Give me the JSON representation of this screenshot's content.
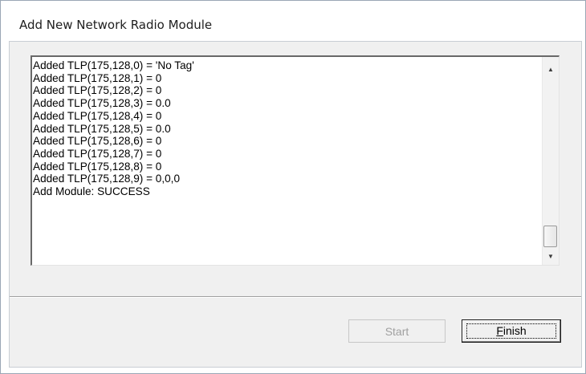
{
  "window": {
    "title": "Add New Network Radio Module"
  },
  "log": {
    "lines": [
      "Added TLP(175,128,0) = 'No Tag'",
      "Added TLP(175,128,1) = 0",
      "Added TLP(175,128,2) = 0",
      "Added TLP(175,128,3) = 0.0",
      "Added TLP(175,128,4) = 0",
      "Added TLP(175,128,5) = 0.0",
      "Added TLP(175,128,6) = 0",
      "Added TLP(175,128,7) = 0",
      "Added TLP(175,128,8) = 0",
      "Added TLP(175,128,9) = 0,0,0",
      "Add Module: SUCCESS"
    ],
    "scroll_position": 0.92
  },
  "buttons": {
    "start_label": "Start",
    "start_enabled": false,
    "finish_mnemonic": "F",
    "finish_rest": "inish"
  },
  "icons": {
    "scroll_up": "scroll-up-arrow",
    "scroll_down": "scroll-down-arrow"
  }
}
